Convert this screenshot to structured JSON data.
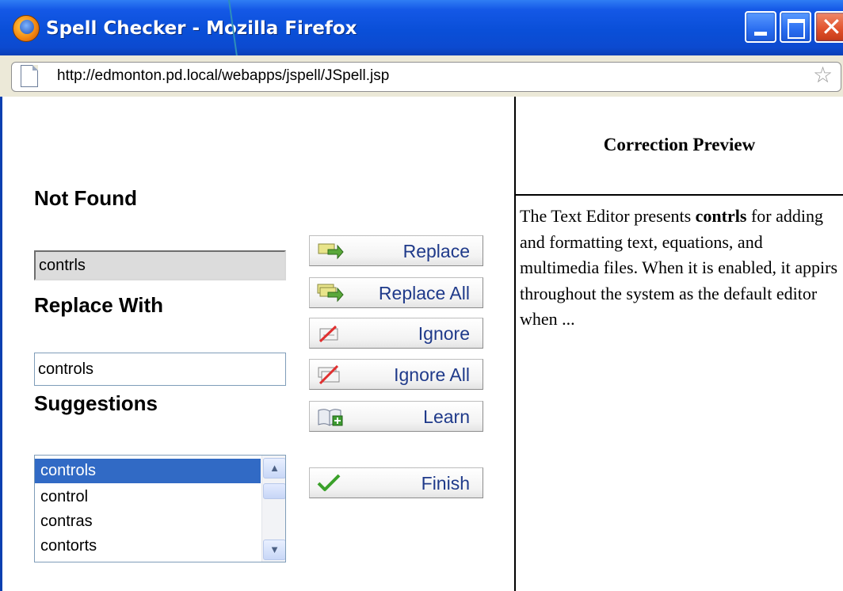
{
  "window": {
    "title": "Spell Checker - Mozilla Firefox",
    "url": "http://edmonton.pd.local/webapps/jspell/JSpell.jsp"
  },
  "spellcheck": {
    "not_found_label": "Not Found",
    "not_found_word": "contrls",
    "replace_with_label": "Replace With",
    "replace_with_value": "controls",
    "suggestions_label": "Suggestions",
    "suggestions": [
      "controls",
      "control",
      "contras",
      "contorts"
    ],
    "selected_suggestion": "controls"
  },
  "actions": {
    "replace": "Replace",
    "replace_all": "Replace All",
    "ignore": "Ignore",
    "ignore_all": "Ignore All",
    "learn": "Learn",
    "finish": "Finish"
  },
  "preview": {
    "title": "Correction Preview",
    "text_before": "The Text Editor presents ",
    "highlighted_word": "contrls",
    "text_after": " for adding and formatting text, equations, and multimedia files. When it is enabled, it appirs throughout the system as the default editor when ..."
  },
  "colors": {
    "titlebar": "#0a4fd8",
    "selection": "#316ac5",
    "button_text": "#1f3a8a"
  },
  "icons": {
    "app": "firefox-icon",
    "page": "page-icon",
    "bookmark": "star-icon",
    "replace": "replace-arrow-icon",
    "replace_all": "replace-all-arrow-icon",
    "ignore": "ignore-icon",
    "ignore_all": "ignore-all-icon",
    "learn": "learn-book-icon",
    "finish": "checkmark-icon"
  }
}
